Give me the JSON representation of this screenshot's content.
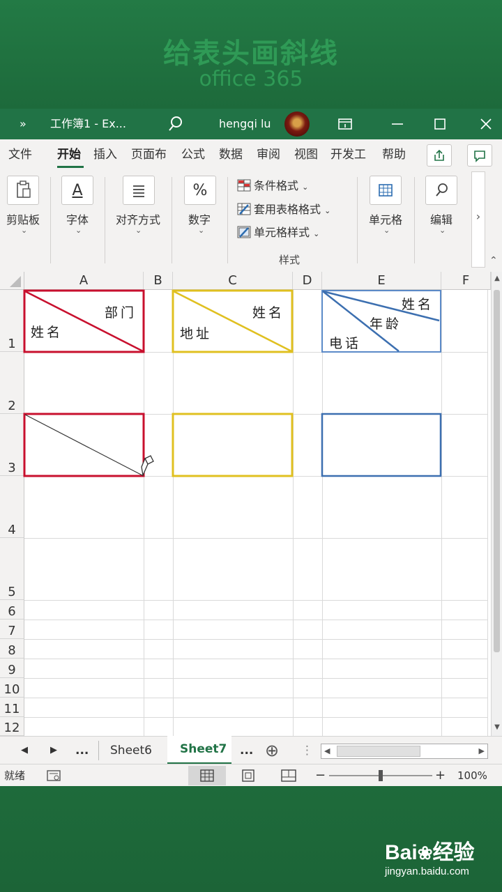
{
  "banner": {
    "title": "给表头画斜线",
    "subtitle": "office 365"
  },
  "titlebar": {
    "more": "»",
    "doc_title": "工作簿1 - Ex...",
    "user_name": "hengqi lu"
  },
  "menu": {
    "items": [
      "文件",
      "开始",
      "插入",
      "页面布",
      "公式",
      "数据",
      "审阅",
      "视图",
      "开发工",
      "帮助"
    ],
    "active": "开始"
  },
  "ribbon": {
    "clipboard": "剪贴板",
    "font": "字体",
    "font_icon": "A",
    "align": "对齐方式",
    "number": "数字",
    "number_icon": "%",
    "styles": {
      "conditional": "条件格式",
      "table_format": "套用表格格式",
      "cell_style": "单元格样式",
      "group_label": "样式"
    },
    "cells": "单元格",
    "edit": "编辑",
    "expand": "›",
    "collapse": "⌃"
  },
  "grid": {
    "columns": [
      "A",
      "B",
      "C",
      "D",
      "E",
      "F"
    ],
    "rows": [
      "1",
      "2",
      "3",
      "4",
      "5",
      "6",
      "7",
      "8",
      "9",
      "10",
      "11",
      "12"
    ],
    "cells": {
      "A1_top": "部门",
      "A1_bottom": "姓名",
      "C1_top": "姓名",
      "C1_bottom": "地址",
      "E1_top": "姓名",
      "E1_mid": "年龄",
      "E1_bottom": "电话"
    },
    "colors": {
      "red": "#c8102e",
      "yellow": "#e0c020",
      "blue": "#3c6fb0",
      "blue_light": "#5b8ac8"
    }
  },
  "sheets": {
    "tabs": [
      "Sheet6",
      "Sheet7"
    ],
    "active": "Sheet7",
    "ellipsis": "...",
    "add": "⊕"
  },
  "status": {
    "ready": "就绪",
    "zoom_out": "−",
    "zoom_in": "+",
    "zoom": "100%",
    "zoom_level": 1.0
  },
  "watermark": {
    "brand": "Bai",
    "brand2": "经验",
    "url": "jingyan.baidu.com"
  }
}
